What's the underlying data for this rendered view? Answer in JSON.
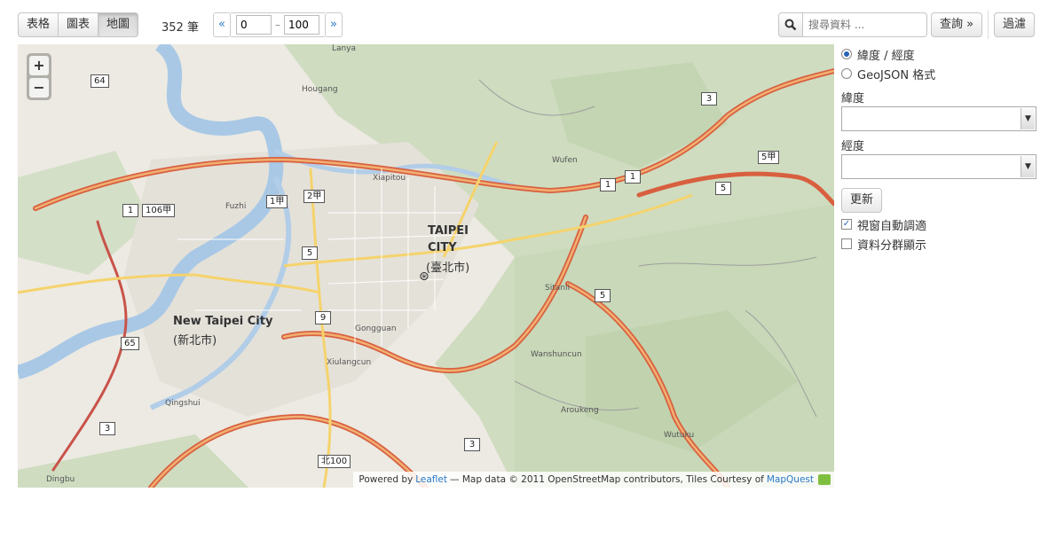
{
  "toolbar": {
    "view_tabs": [
      "表格",
      "圖表",
      "地圖"
    ],
    "active_tab": "地圖",
    "record_count": "352 筆",
    "pager": {
      "prev": "«",
      "next": "»",
      "from": "0",
      "to": "100",
      "dash": "–"
    },
    "search_placeholder": "搜尋資料 ...",
    "query_label": "查詢 »",
    "filter_label": "過濾"
  },
  "map": {
    "zoom_in": "+",
    "zoom_out": "−",
    "attribution": {
      "prefix": "Powered by",
      "leaflet": "Leaflet",
      "middle": "— Map data © 2011 OpenStreetMap contributors, Tiles Courtesy of",
      "mapquest": "MapQuest"
    },
    "labels": {
      "taipei": "TAIPEI",
      "city": "CITY",
      "taipei_zh": "(臺北市)",
      "new_taipei": "New Taipei City",
      "new_taipei_zh": "(新北市)",
      "xiulangcun": "Xiulangcun",
      "gongguan": "Gongguan",
      "sitanli": "Sitanli",
      "wanshuncun": "Wanshuncun",
      "aroukeng": "Aroukeng",
      "wutuku": "Wutuku",
      "hougang": "Hougang",
      "xiapitou": "Xiapitou",
      "fuzhi": "Fuzhi",
      "wufen": "Wufen",
      "qingshui": "Qingshui",
      "dingbu": "Dingbu",
      "lanya": "Lanya"
    },
    "shields": [
      "64",
      "1",
      "106甲",
      "1甲",
      "2甲",
      "5",
      "9",
      "65",
      "3",
      "3",
      "北100",
      "1",
      "1",
      "3",
      "5",
      "5甲",
      "5"
    ]
  },
  "panel": {
    "coord_mode_options": [
      "緯度 / 經度",
      "GeoJSON 格式"
    ],
    "coord_mode_selected": "緯度 / 經度",
    "lat_label": "緯度",
    "lng_label": "經度",
    "update_label": "更新",
    "auto_fit_label": "視窗自動調適",
    "auto_fit_checked": true,
    "cluster_label": "資料分群顯示",
    "cluster_checked": false
  }
}
